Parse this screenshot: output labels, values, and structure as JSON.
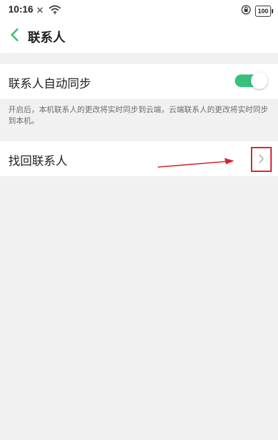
{
  "status_bar": {
    "time": "10:16",
    "battery": "100"
  },
  "header": {
    "title": "联系人"
  },
  "sync": {
    "label": "联系人自动同步",
    "enabled": true,
    "description": "开启后，本机联系人的更改将实时同步到云端，云端联系人的更改将实时同步到本机。"
  },
  "recover": {
    "label": "找回联系人"
  },
  "colors": {
    "accent": "#36c27b",
    "annotation": "#d6262c",
    "background": "#f1f1f1"
  },
  "icons": {
    "back": "chevron-left-icon",
    "chevron": "chevron-right-icon"
  }
}
